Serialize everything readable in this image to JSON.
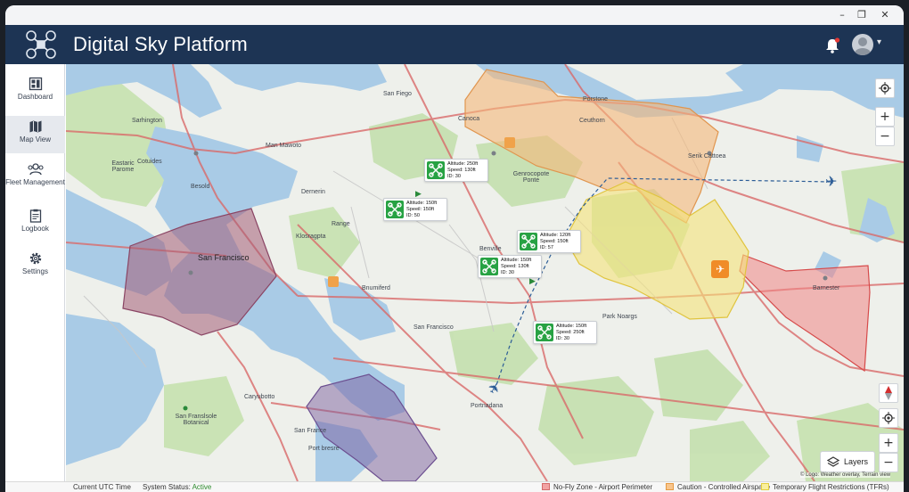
{
  "app": {
    "title": "Digital Sky Platform"
  },
  "window": {
    "minimize": "–",
    "maximize": "❐",
    "close": "✕"
  },
  "nav": [
    {
      "label": "Dashboard",
      "icon": "dashboard-icon"
    },
    {
      "label": "Map View",
      "icon": "map-icon",
      "active": true
    },
    {
      "label": "Fleet Management",
      "icon": "fleet-icon"
    },
    {
      "label": "Logbook",
      "icon": "logbook-icon"
    },
    {
      "label": "Settings",
      "icon": "settings-icon"
    }
  ],
  "map": {
    "labels": {
      "san_fiego": "San Fiego",
      "portone": "Porstone",
      "canoca": "Canoca",
      "ceuthorn": "Ceuthorn",
      "sarhington": "Sarhington",
      "man_maworo": "Man Mawoto",
      "genrocopote": "Genrocopote Ponte",
      "serik": "Serik Cattoea",
      "eastaric": "Eastaric Parome",
      "cotuides": "Cotuides",
      "besold": "Besold",
      "dernerin": "Dernerin",
      "range": "Range",
      "klosragpta": "Klosragpta",
      "san_francisco_main": "San Francisco",
      "benville": "Benville",
      "bnumiferd": "Bnumiferd",
      "barnester": "Barnester",
      "san_francisco_2": "San Francisco",
      "park_noargs": "Park Noargs",
      "caryubotto": "Caryubotto",
      "sf_botanical": "San Franslsole Botanical",
      "portnadana": "Portnadana",
      "san_france": "San France",
      "port_bresre": "Port bresre"
    },
    "drones": [
      {
        "altitude": "Altitude: 250ft",
        "speed": "Speed: 130ft",
        "id": "ID: 30"
      },
      {
        "altitude": "Altitude: 150ft",
        "speed": "Speeil: 150ft",
        "id": "ID: 50"
      },
      {
        "altitude": "Altitude: 120ft",
        "speed": "Speed: 150ft",
        "id": "ID: 57"
      },
      {
        "altitude": "Altitude: 150ft",
        "speed": "Speed: 130ft",
        "id": "ID: 30"
      },
      {
        "altitude": "Altitude: 150ft",
        "speed": "Speed: 250ft",
        "id": "ID: 30"
      }
    ],
    "controls": {
      "zoom_in": "+",
      "zoom_out": "−",
      "layers": "Layers",
      "attribution": "© Logo: Weather overlay, Terrain view"
    }
  },
  "status": {
    "time_label": "Current UTC Time",
    "system_label": "System Status:",
    "system_value": "Active",
    "legend": [
      {
        "label": "No-Fly Zone - Airport Perimeter",
        "fill": "#f2a3a3",
        "stroke": "#d46a6a"
      },
      {
        "label": "Caution - Controlled Airspace",
        "fill": "#f8c58d",
        "stroke": "#e59a44"
      },
      {
        "label": "Temporary Flight Restrictions (TFRs)",
        "fill": "#f9ef9d",
        "stroke": "#e3cf3e"
      }
    ]
  },
  "colors": {
    "header": "#1d3454",
    "water": "#a9cbe6",
    "park": "#c7e1b2",
    "road": "#d96a6a",
    "no_fly": "#e07f8f",
    "caution": "#f5b77a",
    "tfr": "#f5e27a",
    "status_active": "#2e8b2e"
  }
}
